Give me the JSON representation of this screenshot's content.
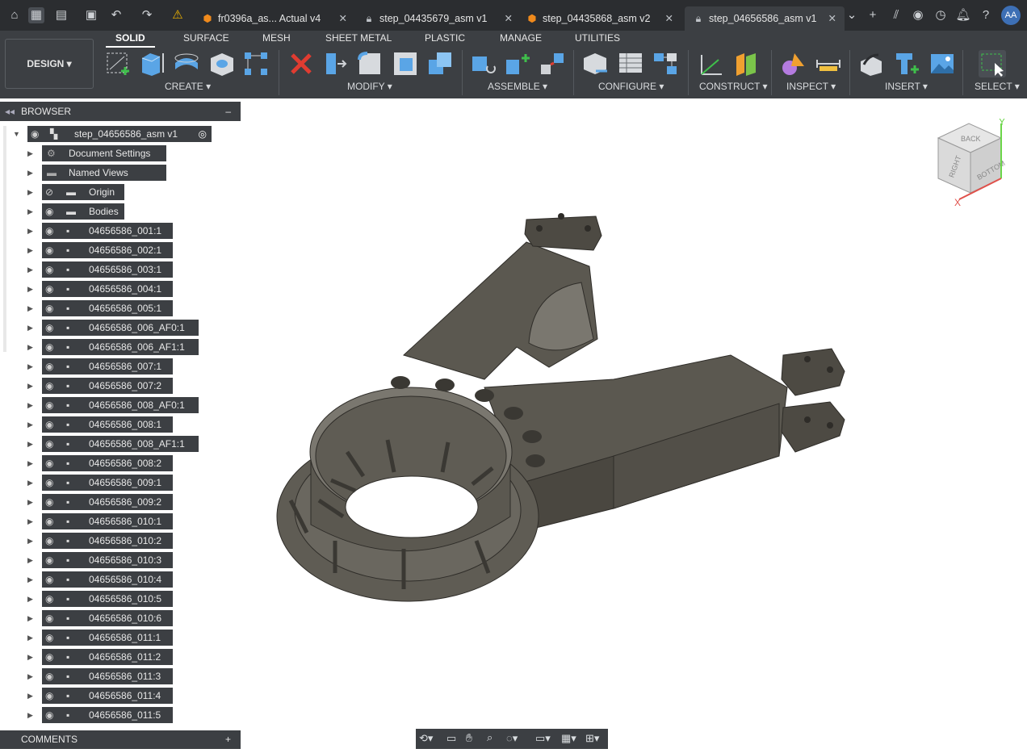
{
  "tabs": [
    {
      "label": "fr0396a_as... Actual v4",
      "icon": "orange-cube-icon"
    },
    {
      "label": "step_04435679_asm v1",
      "icon": "lock-icon"
    },
    {
      "label": "step_04435868_asm v2",
      "icon": "orange-cube-icon"
    },
    {
      "label": "step_04656586_asm v1",
      "icon": "lock-icon",
      "active": true
    }
  ],
  "user": {
    "initials": "AA"
  },
  "workspace": {
    "label": "DESIGN"
  },
  "toolbar_tabs": [
    "SOLID",
    "SURFACE",
    "MESH",
    "SHEET METAL",
    "PLASTIC",
    "MANAGE",
    "UTILITIES"
  ],
  "groups": {
    "create": "CREATE",
    "modify": "MODIFY",
    "assemble": "ASSEMBLE",
    "configure": "CONFIGURE",
    "construct": "CONSTRUCT",
    "inspect": "INSPECT",
    "insert": "INSERT",
    "select": "SELECT"
  },
  "browser": {
    "title": "BROWSER",
    "root": "step_04656586_asm v1",
    "items": [
      {
        "label": "Document Settings",
        "icon": "gear-icon"
      },
      {
        "label": "Named Views",
        "icon": "folder-icon"
      },
      {
        "label": "Origin",
        "icon": "folder-icon",
        "hidden": true
      },
      {
        "label": "Bodies",
        "icon": "folder-icon"
      },
      {
        "label": "04656586_001:1"
      },
      {
        "label": "04656586_002:1"
      },
      {
        "label": "04656586_003:1"
      },
      {
        "label": "04656586_004:1"
      },
      {
        "label": "04656586_005:1"
      },
      {
        "label": "04656586_006_AF0:1"
      },
      {
        "label": "04656586_006_AF1:1"
      },
      {
        "label": "04656586_007:1"
      },
      {
        "label": "04656586_007:2"
      },
      {
        "label": "04656586_008_AF0:1"
      },
      {
        "label": "04656586_008:1"
      },
      {
        "label": "04656586_008_AF1:1"
      },
      {
        "label": "04656586_008:2"
      },
      {
        "label": "04656586_009:1"
      },
      {
        "label": "04656586_009:2"
      },
      {
        "label": "04656586_010:1"
      },
      {
        "label": "04656586_010:2"
      },
      {
        "label": "04656586_010:3"
      },
      {
        "label": "04656586_010:4"
      },
      {
        "label": "04656586_010:5"
      },
      {
        "label": "04656586_010:6"
      },
      {
        "label": "04656586_011:1"
      },
      {
        "label": "04656586_011:2"
      },
      {
        "label": "04656586_011:3"
      },
      {
        "label": "04656586_011:4"
      },
      {
        "label": "04656586_011:5"
      }
    ]
  },
  "comments": {
    "title": "COMMENTS"
  },
  "viewcube": {
    "faces": [
      "BACK",
      "RIGHT",
      "BOTTOM"
    ],
    "axes": [
      "Y",
      "X"
    ]
  },
  "colors": {
    "titlebar": "#2b2d30",
    "toolbar": "#3c3f43",
    "accent": "#3d6fb5",
    "model": "#5b5850"
  }
}
